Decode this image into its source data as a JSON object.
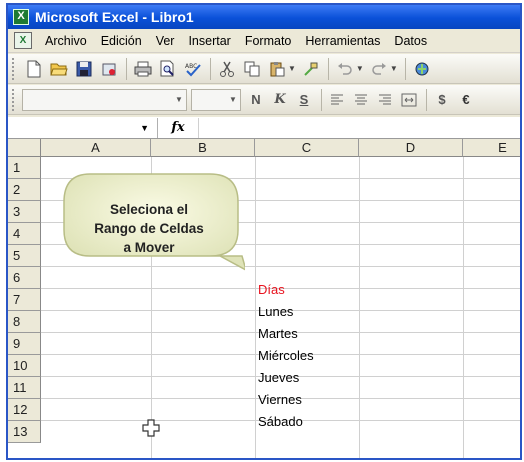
{
  "window": {
    "title": "Microsoft Excel - Libro1"
  },
  "menu": [
    "Archivo",
    "Edición",
    "Ver",
    "Insertar",
    "Formato",
    "Herramientas",
    "Datos"
  ],
  "formula_bar": {
    "fx_label": "fx"
  },
  "grid": {
    "columns": [
      "A",
      "B",
      "C",
      "D",
      "E"
    ],
    "rows": [
      "1",
      "2",
      "3",
      "4",
      "5",
      "6",
      "7",
      "8",
      "9",
      "10",
      "11",
      "12",
      "13"
    ],
    "column_c": [
      "Días",
      "Lunes",
      "Martes",
      "Miércoles",
      "Jueves",
      "Viernes",
      "Sábado"
    ],
    "header_color": "#e8121e"
  },
  "callout": {
    "lines": [
      "Seleciona el",
      "Rango de Celdas",
      "a Mover"
    ]
  },
  "icons": {
    "standard": [
      "new-icon",
      "open-icon",
      "save-icon",
      "permission-icon",
      "print-icon",
      "print-preview-icon",
      "spelling-icon",
      "cut-icon",
      "copy-icon",
      "paste-icon",
      "format-painter-icon",
      "undo-icon",
      "redo-icon",
      "hyperlink-icon"
    ],
    "format": [
      "bold-icon",
      "italic-icon",
      "underline-icon",
      "align-left-icon",
      "center-icon",
      "align-right-icon",
      "merge-center-icon",
      "currency-icon",
      "euro-icon"
    ]
  }
}
